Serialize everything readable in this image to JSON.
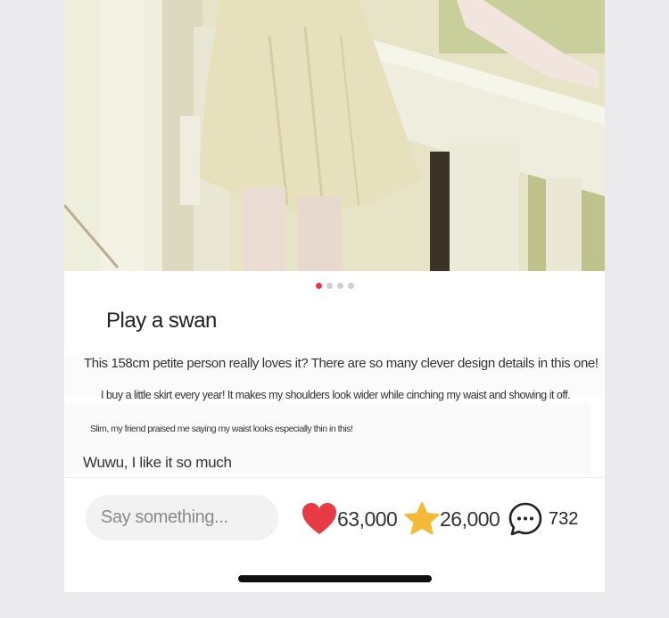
{
  "post": {
    "title": "Play a swan",
    "paragraphs": [
      "This 158cm petite person really loves it? There are so many clever design details in this one!",
      "I buy a little skirt every year! It makes my shoulders look wider while cinching my waist and showing it off.",
      "Slim, my friend praised me saying my waist looks especially thin in this!",
      "Wuwu, I like it so much"
    ],
    "carousel": {
      "total": 4,
      "active": 1
    }
  },
  "bottom_bar": {
    "comment_placeholder": "Say something...",
    "likes": "63,000",
    "favorites": "26,000",
    "comments": "732"
  },
  "colors": {
    "accent_red": "#e63b45",
    "star_yellow": "#f5b93a"
  },
  "icons": {
    "like": "heart-icon",
    "favorite": "star-icon",
    "comment": "speech-bubble-icon"
  }
}
